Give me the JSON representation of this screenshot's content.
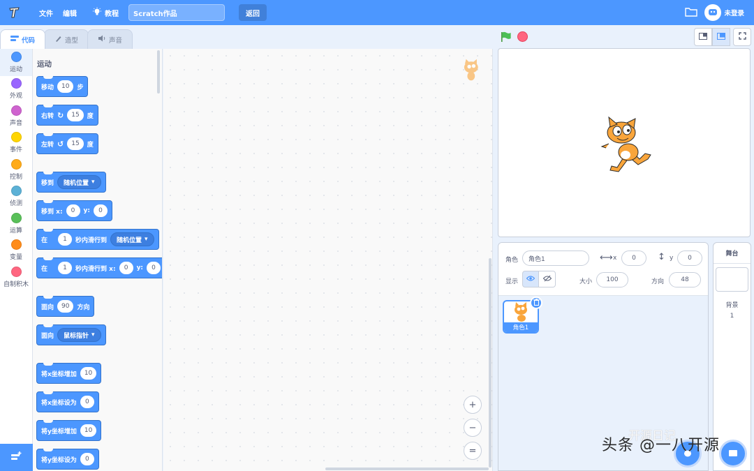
{
  "menubar": {
    "file": "文件",
    "edit": "编辑",
    "tutorials": "教程",
    "project_title": "Scratch作品",
    "back": "返回",
    "account": "未登录"
  },
  "tabs": {
    "code": "代码",
    "costumes": "造型",
    "sounds": "声音"
  },
  "categories": [
    {
      "label": "运动",
      "color": "#4c97ff"
    },
    {
      "label": "外观",
      "color": "#9966ff"
    },
    {
      "label": "声音",
      "color": "#cf63cf"
    },
    {
      "label": "事件",
      "color": "#ffd500"
    },
    {
      "label": "控制",
      "color": "#ffab19"
    },
    {
      "label": "侦测",
      "color": "#5cb1d6"
    },
    {
      "label": "运算",
      "color": "#59c059"
    },
    {
      "label": "变量",
      "color": "#ff8c1a"
    },
    {
      "label": "自制积木",
      "color": "#ff6680"
    }
  ],
  "palette": {
    "title": "运动",
    "move": {
      "label": "移动",
      "value": "10",
      "unit": "步"
    },
    "turn_right": {
      "label": "右转",
      "value": "15",
      "unit": "度"
    },
    "turn_left": {
      "label": "左转",
      "value": "15",
      "unit": "度"
    },
    "goto": {
      "label": "移到",
      "option": "随机位置"
    },
    "goto_xy": {
      "label": "移到 x:",
      "x": "0",
      "ylabel": "y:",
      "y": "0"
    },
    "glide_to": {
      "pre": "在",
      "secs": "1",
      "mid": "秒内滑行到",
      "option": "随机位置"
    },
    "glide_xy": {
      "pre": "在",
      "secs": "1",
      "mid": "秒内滑行到 x:",
      "x": "0",
      "ylabel": "y:",
      "y": "0"
    },
    "point_dir": {
      "label": "面向",
      "value": "90",
      "unit": "方向"
    },
    "point_towards": {
      "label": "面向",
      "option": "鼠标指针"
    },
    "change_x": {
      "label": "将x坐标增加",
      "value": "10"
    },
    "set_x": {
      "label": "将x坐标设为",
      "value": "0"
    },
    "change_y": {
      "label": "将y坐标增加",
      "value": "10"
    },
    "set_y": {
      "label": "将y坐标设为",
      "value": "0"
    }
  },
  "zoom": {
    "in": "+",
    "out": "−",
    "reset": "="
  },
  "sprite_info": {
    "sprite_label": "角色",
    "sprite_name": "角色1",
    "x_label": "x",
    "x": "0",
    "y_label": "y",
    "y": "0",
    "show_label": "显示",
    "size_label": "大小",
    "size": "100",
    "direction_label": "方向",
    "direction": "48"
  },
  "sprites": [
    {
      "name": "角色1"
    }
  ],
  "stage_pane": {
    "title": "舞台",
    "backdrops_label": "背景",
    "backdrop_count": "1"
  },
  "watermark": {
    "line1": "开源日记",
    "line2": "头条 @一八开源"
  },
  "colors": {
    "accent": "#4c97ff",
    "flag": "#4cbf56",
    "stop": "#ff6680"
  }
}
